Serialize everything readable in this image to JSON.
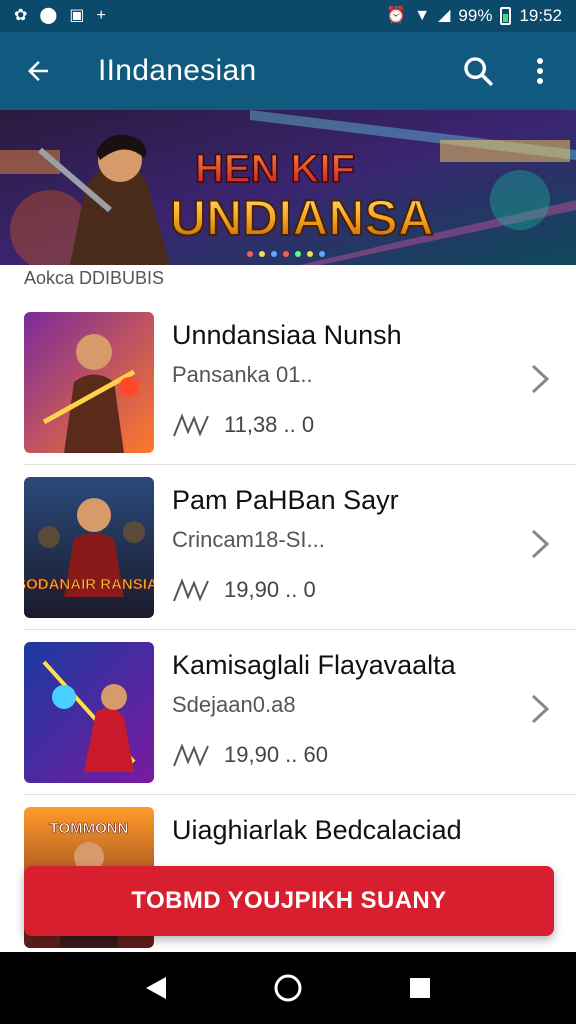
{
  "status_bar": {
    "battery": "99%",
    "time": "19:52"
  },
  "app_bar": {
    "title": "IIndanesian"
  },
  "banner": {
    "title_top": "HEN KIF",
    "title_main": "UNDIANSA"
  },
  "section": {
    "label": "Aokca DDIBUBIS"
  },
  "games": [
    {
      "title": "Unndansiaa Nunsh",
      "subtitle": "Pansanka 01..",
      "meta": "11,38 .. 0"
    },
    {
      "title": "Pam PaHBan Sayr",
      "subtitle": "Crincam18-SI...",
      "meta": "19,90 .. 0",
      "thumb_text": "SODANAIR RANSIAI"
    },
    {
      "title": "Kamisaglali Flayavaalta",
      "subtitle": "Sdejaan0.a8",
      "meta": "19,90 .. 60"
    },
    {
      "title": "Uiaghiarlak Bedcalaciad",
      "subtitle": "",
      "meta": "",
      "thumb_text": "TOMMONN"
    }
  ],
  "cta": {
    "label": "TOBMD YOUJPIKH SUANY"
  },
  "colors": {
    "app_bar": "#0f5a7e",
    "status_bar": "#0b4a6a",
    "cta": "#d81f2f"
  }
}
